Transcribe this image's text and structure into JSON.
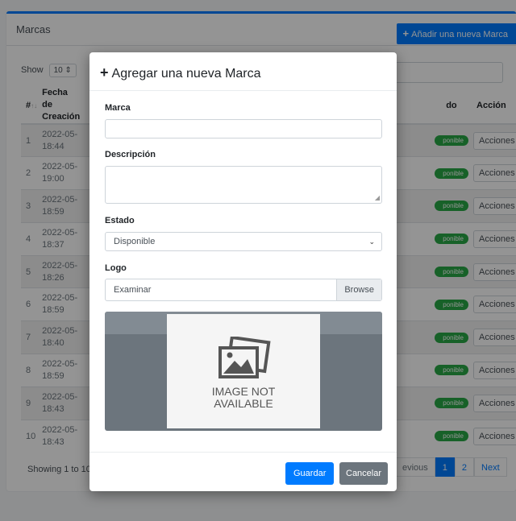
{
  "card": {
    "title": "Marcas",
    "add_button": "Añadir una nueva Marca"
  },
  "list_controls": {
    "show_label": "Show",
    "page_size": "10"
  },
  "table": {
    "headers": {
      "num": "#",
      "fecha_line1": "Fecha de",
      "fecha_line2": "Creación",
      "estado": "do",
      "accion": "Acción"
    },
    "rows": [
      {
        "num": "1",
        "date": "2022-05-",
        "time": "18:44",
        "status": "ponible",
        "action": "Acciones"
      },
      {
        "num": "2",
        "date": "2022-05-",
        "time": "19:00",
        "status": "ponible",
        "action": "Acciones"
      },
      {
        "num": "3",
        "date": "2022-05-",
        "time": "18:59",
        "status": "ponible",
        "action": "Acciones"
      },
      {
        "num": "4",
        "date": "2022-05-",
        "time": "18:37",
        "status": "ponible",
        "action": "Acciones"
      },
      {
        "num": "5",
        "date": "2022-05-",
        "time": "18:26",
        "status": "ponible",
        "action": "Acciones"
      },
      {
        "num": "6",
        "date": "2022-05-",
        "time": "18:59",
        "status": "ponible",
        "action": "Acciones"
      },
      {
        "num": "7",
        "date": "2022-05-",
        "time": "18:40",
        "status": "ponible",
        "action": "Acciones"
      },
      {
        "num": "8",
        "date": "2022-05-",
        "time": "18:59",
        "status": "ponible",
        "action": "Acciones"
      },
      {
        "num": "9",
        "date": "2022-05-",
        "time": "18:43",
        "status": "ponible",
        "action": "Acciones"
      },
      {
        "num": "10",
        "date": "2022-05-",
        "time": "18:43",
        "status": "ponible",
        "action": "Acciones"
      }
    ]
  },
  "footer": {
    "info": "Showing 1 to 10",
    "pagination": {
      "previous": "evious",
      "pages": [
        "1",
        "2"
      ],
      "next": "Next",
      "active": "1"
    }
  },
  "modal": {
    "title": "Agregar una nueva Marca",
    "marca_label": "Marca",
    "marca_value": "",
    "descripcion_label": "Descripción",
    "descripcion_value": "",
    "estado_label": "Estado",
    "estado_value": "Disponible",
    "logo_label": "Logo",
    "logo_placeholder": "Examinar",
    "browse_label": "Browse",
    "image_text_line1": "IMAGE NOT",
    "image_text_line2": "AVAILABLE",
    "save_label": "Guardar",
    "cancel_label": "Cancelar"
  },
  "colors": {
    "primary": "#007bff",
    "success": "#28a745",
    "secondary": "#6c757d"
  },
  "icons": {
    "plus": "plus-icon",
    "sort": "sort-icon",
    "caret": "caret-down-icon",
    "chevron": "chevron-down-icon",
    "no_image": "picture-icon"
  }
}
